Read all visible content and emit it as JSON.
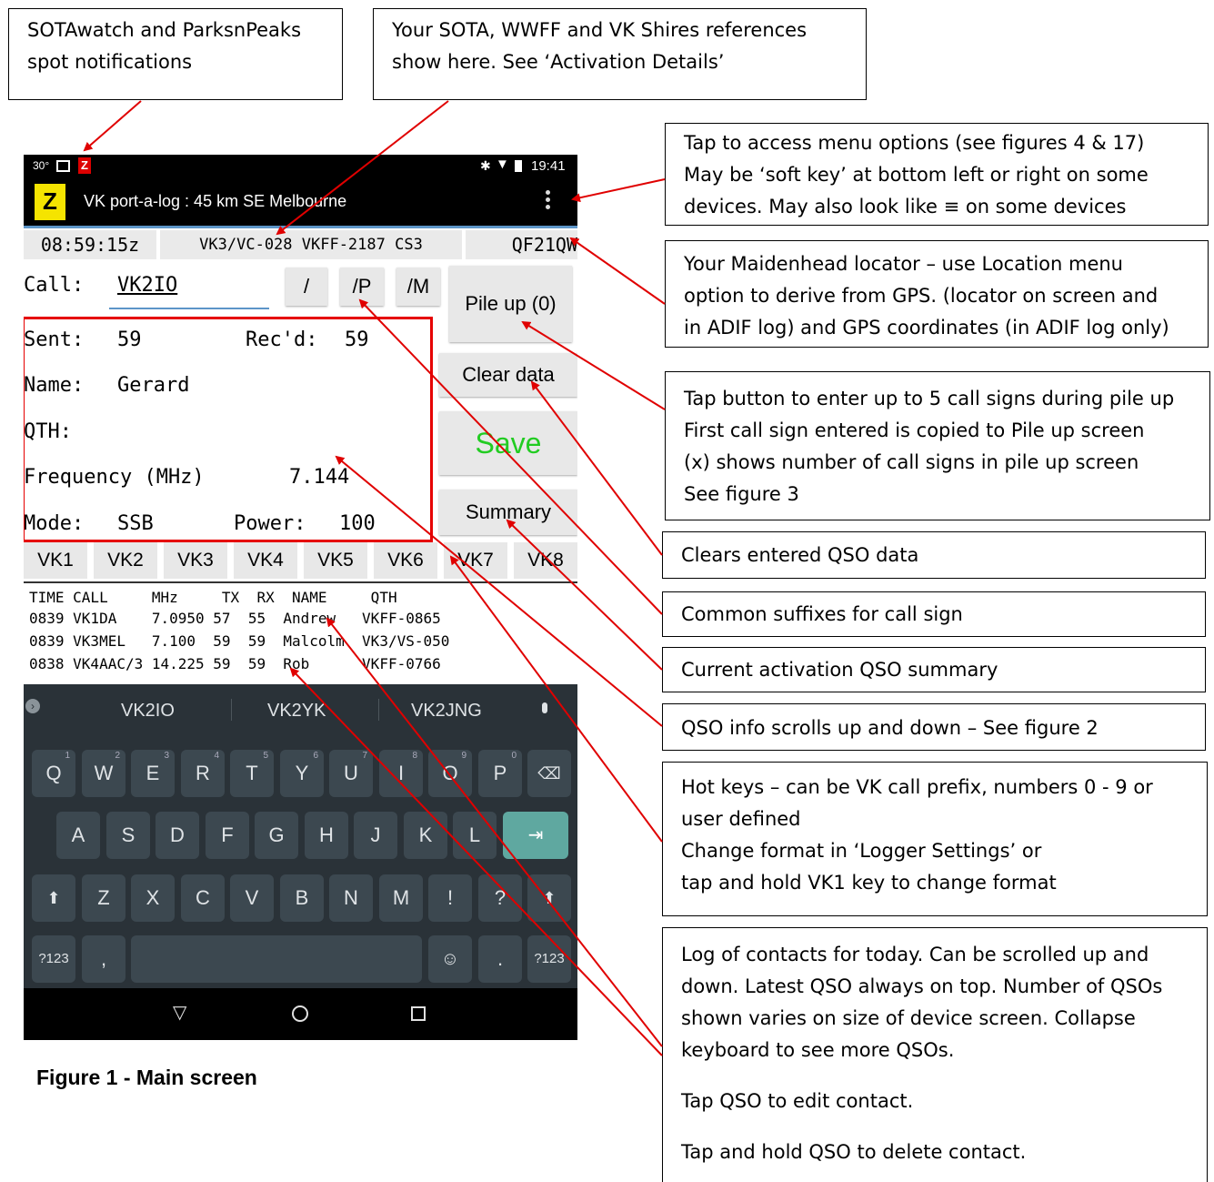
{
  "callouts": {
    "spots": [
      "SOTAwatch and ParksnPeaks",
      "spot notifications"
    ],
    "refs": [
      "Your SOTA, WWFF and VK Shires references",
      "show here. See ‘Activation Details’"
    ],
    "menu": [
      "Tap to access menu options (see figures 4 & 17)",
      "May be ‘soft key’ at bottom left or right on some",
      "devices. May also look like ≡ on some devices"
    ],
    "locator": [
      "Your Maidenhead locator – use Location menu",
      "option to derive from GPS.  (locator on screen and",
      "in ADIF log) and GPS coordinates (in ADIF log only)"
    ],
    "pileup": [
      "Tap button to enter up to 5 call signs during pile up",
      "First call sign entered is copied to Pile up screen",
      "(x) shows number of call signs in pile up screen",
      "See figure 3"
    ],
    "clear": [
      "Clears entered QSO data"
    ],
    "suffix": [
      "Common suffixes for call sign"
    ],
    "summary": [
      "Current activation QSO summary"
    ],
    "scroll": [
      "QSO info scrolls up and down – See figure 2"
    ],
    "hotkeys": [
      "Hot keys – can be VK call prefix, numbers 0 - 9 or",
      "user defined",
      "Change format in ‘Logger Settings’ or",
      "tap and hold VK1 key to change format"
    ],
    "log": [
      "Log of contacts for today. Can be scrolled up and",
      "down. Latest QSO always on top. Number of QSOs",
      "shown varies on size of device screen. Collapse",
      "keyboard to see more QSOs.",
      "Tap QSO to edit contact.",
      "Tap and hold QSO to delete contact."
    ]
  },
  "phone": {
    "status": {
      "temp": "30°",
      "time": "19:41"
    },
    "title": "VK port-a-log : 45 km SE Melbourne",
    "utc": "08:59:15z",
    "refs": "VK3/VC-028 VKFF-2187 CS3",
    "locator": "QF21QW",
    "call_label": "Call:",
    "call_value": "VK2IO",
    "suffixes": [
      "/",
      "/P",
      "/M"
    ],
    "buttons": {
      "pileup": "Pile up (0)",
      "clear": "Clear data",
      "save": "Save",
      "summary": "Summary"
    },
    "fields": {
      "sent_label": "Sent:",
      "sent": "59",
      "recd_label": "Rec'd:",
      "recd": "59",
      "name_label": "Name:",
      "name": "Gerard",
      "qth_label": "QTH:",
      "freq_label": "Frequency (MHz)",
      "freq": "7.144",
      "mode_label": "Mode:",
      "mode": "SSB",
      "power_label": "Power:",
      "power": "100"
    },
    "hotkeys": [
      "VK1",
      "VK2",
      "VK3",
      "VK4",
      "VK5",
      "VK6",
      "VK7",
      "VK8"
    ],
    "log_header": "TIME CALL     MHz     TX  RX  NAME     QTH",
    "log_rows": [
      "0839 VK1DA    7.0950 57  55  Andrew   VKFF-0865",
      "0839 VK3MEL   7.100  59  59  Malcolm  VK3/VS-050",
      "0838 VK4AAC/3 14.225 59  59  Rob      VKFF-0766"
    ],
    "suggestions": [
      "VK2IO",
      "VK2YK",
      "VK2JNG"
    ],
    "keys_row1": [
      "Q",
      "W",
      "E",
      "R",
      "T",
      "Y",
      "U",
      "I",
      "O",
      "P"
    ],
    "keys_row1_nums": [
      "1",
      "2",
      "3",
      "4",
      "5",
      "6",
      "7",
      "8",
      "9",
      "0"
    ],
    "keys_row2": [
      "A",
      "S",
      "D",
      "F",
      "G",
      "H",
      "J",
      "K",
      "L"
    ],
    "keys_row3": [
      "Z",
      "X",
      "C",
      "V",
      "B",
      "N",
      "M",
      "!",
      "?"
    ],
    "keys_row4": {
      "sym": "?123",
      "comma": ",",
      "period": ".",
      "sym2": "?123"
    }
  },
  "caption": "Figure 1 - Main screen",
  "colors": {
    "arrow": "#e00000",
    "save_green": "#22cc22",
    "highlight_box": "#e60000",
    "enter_key": "#5fa8a0"
  }
}
